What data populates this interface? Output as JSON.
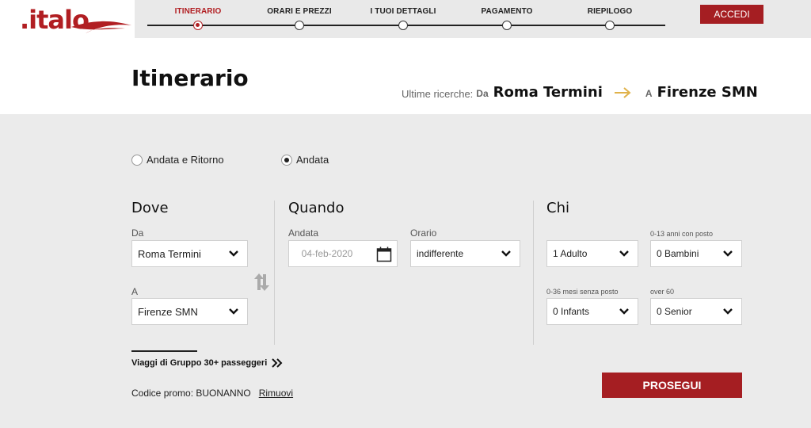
{
  "header": {
    "logo_text": ".italo",
    "login_label": "ACCEDI",
    "steps": [
      {
        "label": "ITINERARIO",
        "active": true
      },
      {
        "label": "ORARI E PREZZI",
        "active": false
      },
      {
        "label": "I TUOI DETTAGLI",
        "active": false
      },
      {
        "label": "PAGAMENTO",
        "active": false
      },
      {
        "label": "RIEPILOGO",
        "active": false
      }
    ]
  },
  "title_band": {
    "page_title": "Itinerario",
    "recent_prefix": "Ultime ricerche:",
    "from_label": "Da",
    "from_city": "Roma Termini",
    "to_label": "A",
    "to_city": "Firenze SMN"
  },
  "trip_type": {
    "options": [
      {
        "label": "Andata e Ritorno",
        "checked": false
      },
      {
        "label": "Andata",
        "checked": true
      }
    ]
  },
  "dove": {
    "title": "Dove",
    "from_label": "Da",
    "from_value": "Roma Termini",
    "to_label": "A",
    "to_value": "Firenze SMN"
  },
  "quando": {
    "title": "Quando",
    "date_label": "Andata",
    "date_value": "04-feb-2020",
    "time_label": "Orario",
    "time_value": "indifferente"
  },
  "chi": {
    "title": "Chi",
    "adults_value": "1 Adulto",
    "children_label": "0-13 anni con posto",
    "children_value": "0 Bambini",
    "infants_label": "0-36 mesi senza posto",
    "infants_value": "0 Infants",
    "senior_label": "over 60",
    "senior_value": "0 Senior"
  },
  "footer": {
    "group_link": "Viaggi di Gruppo 30+ passeggeri",
    "promo_text": "Codice promo: BUONANNO",
    "promo_remove": "Rimuovi",
    "proceed_label": "PROSEGUI"
  },
  "colors": {
    "brand_red": "#a51e22",
    "arrow_gold": "#e0b24a",
    "background": "#ebebeb"
  }
}
